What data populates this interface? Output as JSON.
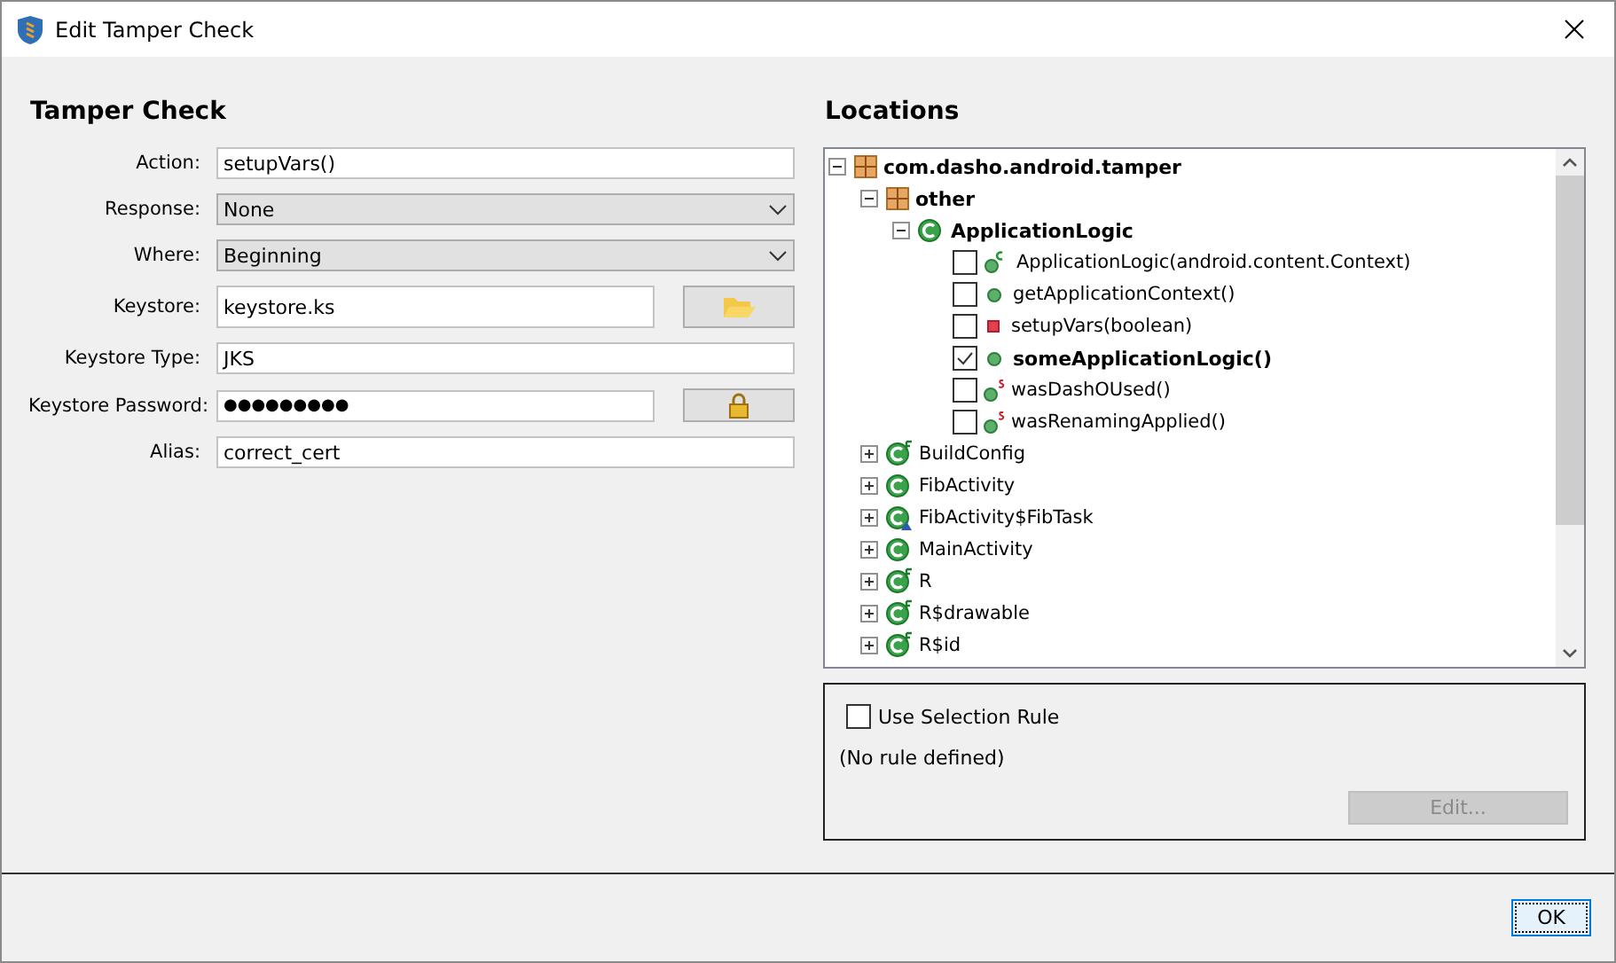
{
  "window": {
    "title": "Edit Tamper Check"
  },
  "form": {
    "heading": "Tamper Check",
    "fields": [
      {
        "kind": "text",
        "label": "Action:",
        "value": "setupVars()"
      },
      {
        "kind": "select",
        "label": "Response:",
        "value": "None"
      },
      {
        "kind": "select",
        "label": "Where:",
        "value": "Beginning"
      },
      {
        "kind": "browse",
        "label": "Keystore:",
        "value": "keystore.ks"
      },
      {
        "kind": "text",
        "label": "Keystore Type:",
        "value": "JKS"
      },
      {
        "kind": "password",
        "label": "Keystore Password:",
        "value": "●●●●●●●●●"
      },
      {
        "kind": "text",
        "label": "Alias:",
        "value": "correct_cert"
      }
    ]
  },
  "locations": {
    "heading": "Locations",
    "tree": [
      {
        "kind": "package",
        "label": "com.dasho.android.tamper",
        "expanded": true,
        "children": [
          {
            "kind": "package",
            "label": "other",
            "expanded": true,
            "children": [
              {
                "kind": "class",
                "label": "ApplicationLogic",
                "expanded": true,
                "children": [
                  {
                    "kind": "constructor",
                    "label": "ApplicationLogic(android.content.Context)",
                    "checked": false
                  },
                  {
                    "kind": "public",
                    "label": "getApplicationContext()",
                    "checked": false
                  },
                  {
                    "kind": "private",
                    "label": "setupVars(boolean)",
                    "checked": false
                  },
                  {
                    "kind": "public",
                    "label": "someApplicationLogic()",
                    "checked": true
                  },
                  {
                    "kind": "static",
                    "label": "wasDashOUsed()",
                    "checked": false
                  },
                  {
                    "kind": "static",
                    "label": "wasRenamingApplied()",
                    "checked": false
                  }
                ]
              }
            ]
          },
          {
            "kind": "final-class",
            "label": "BuildConfig",
            "expanded": false
          },
          {
            "kind": "class",
            "label": "FibActivity",
            "expanded": false
          },
          {
            "kind": "inner-class",
            "label": "FibActivity$FibTask",
            "expanded": false
          },
          {
            "kind": "class",
            "label": "MainActivity",
            "expanded": false
          },
          {
            "kind": "final-class",
            "label": "R",
            "expanded": false
          },
          {
            "kind": "final-class",
            "label": "R$drawable",
            "expanded": false
          },
          {
            "kind": "final-class",
            "label": "R$id",
            "expanded": false
          }
        ]
      }
    ],
    "selection_rule": {
      "label": "Use Selection Rule",
      "checked": false,
      "status": "(No rule defined)",
      "edit_button": {
        "label": "Edit...",
        "disabled": true
      }
    }
  },
  "buttons": [
    {
      "label": "OK"
    }
  ]
}
